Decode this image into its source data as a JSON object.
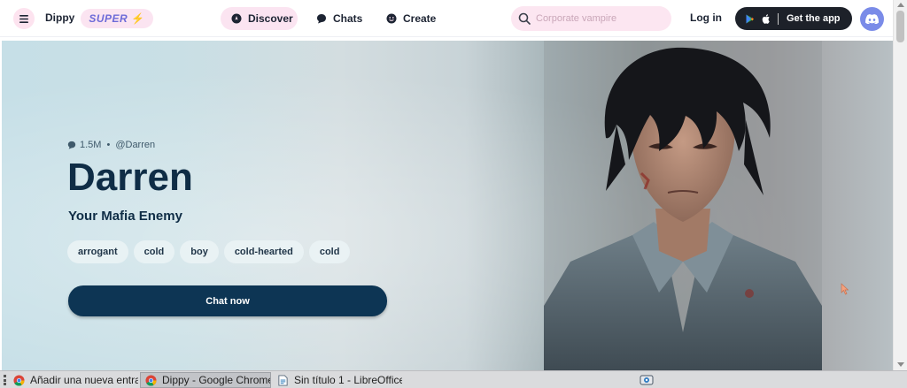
{
  "header": {
    "brand": "Dippy",
    "super_label": "SUPER",
    "nav": [
      {
        "label": "Discover",
        "icon": "compass-icon",
        "active": true
      },
      {
        "label": "Chats",
        "icon": "chat-bubble-icon",
        "active": false
      },
      {
        "label": "Create",
        "icon": "smile-icon",
        "active": false
      }
    ],
    "search_placeholder": "Corporate vampire",
    "login_label": "Log in",
    "get_app_label": "Get the app",
    "accent_color": "#fbe4f1"
  },
  "hero": {
    "chat_count": "1.5M",
    "handle": "@Darren",
    "name": "Darren",
    "tagline": "Your Mafia Enemy",
    "tags": [
      "arrogant",
      "cold",
      "boy",
      "cold-hearted",
      "cold"
    ],
    "cta_label": "Chat now",
    "cta_color": "#0d3554"
  },
  "taskbar": {
    "items": [
      {
        "label": "Añadir una nueva entra...",
        "icon": "chrome-icon"
      },
      {
        "label": "Dippy - Google Chrome",
        "icon": "chrome-icon",
        "active": true
      },
      {
        "label": "Sin título 1 - LibreOffice...",
        "icon": "libreoffice-writer-icon"
      }
    ]
  }
}
